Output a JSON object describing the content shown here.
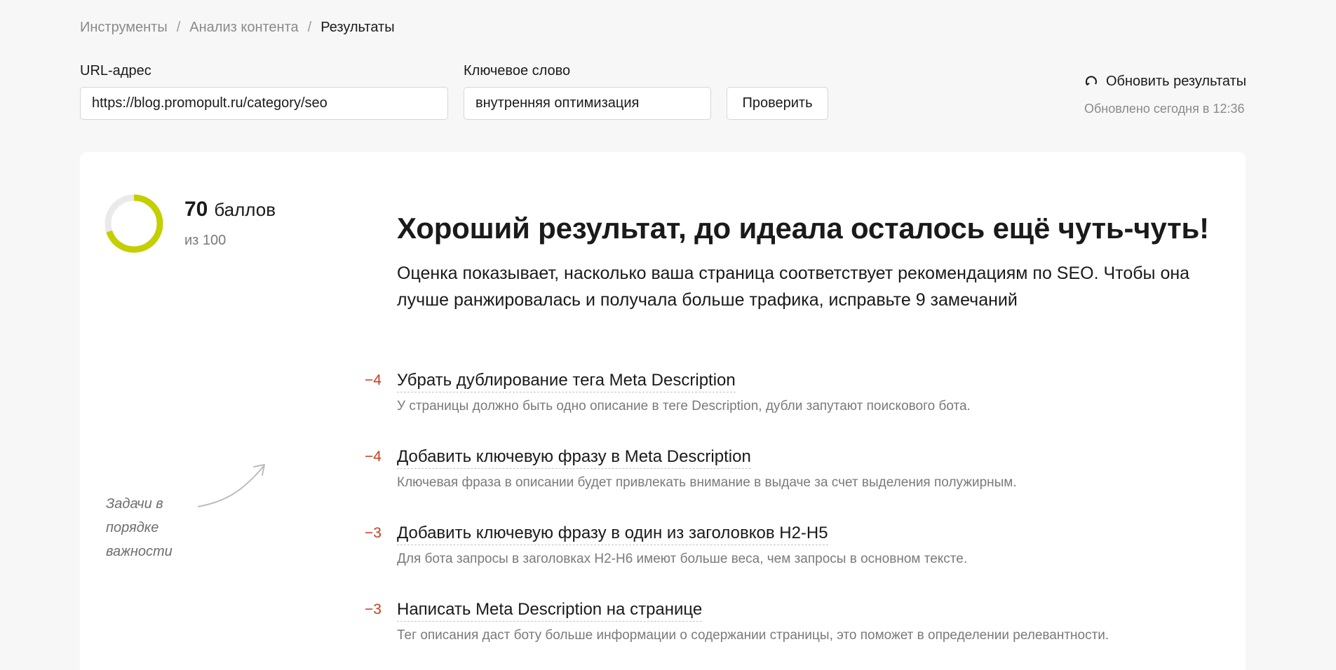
{
  "breadcrumb": {
    "items": [
      "Инструменты",
      "Анализ контента"
    ],
    "separator": "/",
    "current": "Результаты"
  },
  "form": {
    "url_label": "URL-адрес",
    "url_value": "https://blog.promopult.ru/category/seo",
    "keyword_label": "Ключевое слово",
    "keyword_value": "внутренняя оптимизация",
    "check_button": "Проверить"
  },
  "refresh": {
    "icon": "refresh-icon",
    "label": "Обновить результаты",
    "updated": "Обновлено сегодня в 12:36"
  },
  "score": {
    "value": "70",
    "unit": "баллов",
    "of": "из 100",
    "fraction": 0.7,
    "ring_color": "#c4cf00",
    "track_color": "#eaeaea"
  },
  "result": {
    "headline": "Хороший результат, до идеала осталось ещё чуть-чуть!",
    "description": "Оценка показывает, насколько ваша страница соответствует рекомендациям по SEO. Чтобы она лучше ранжировалась и получала больше трафика, исправьте 9 замечаний"
  },
  "note": "Задачи в порядке важности",
  "tasks": [
    {
      "delta": "−4",
      "title": "Убрать дублирование тега Meta Description",
      "desc": "У страницы должно быть одно описание в теге Description, дубли запутают поискового бота."
    },
    {
      "delta": "−4",
      "title": "Добавить ключевую фразу в Meta Description",
      "desc": "Ключевая фраза в описании будет привлекать внимание в выдаче за счет выделения полужирным."
    },
    {
      "delta": "−3",
      "title": "Добавить ключевую фразу в один из заголовков H2-H5",
      "desc": "Для бота запросы в заголовках H2-H6 имеют больше веса, чем запросы в основном тексте."
    },
    {
      "delta": "−3",
      "title": "Написать Meta Description на странице",
      "desc": "Тег описания даст боту больше информации о содержании страницы, это поможет в определении релевантности."
    }
  ],
  "colors": {
    "accent_negative": "#c63b1f",
    "background": "#f7f7f7",
    "card": "#ffffff"
  }
}
